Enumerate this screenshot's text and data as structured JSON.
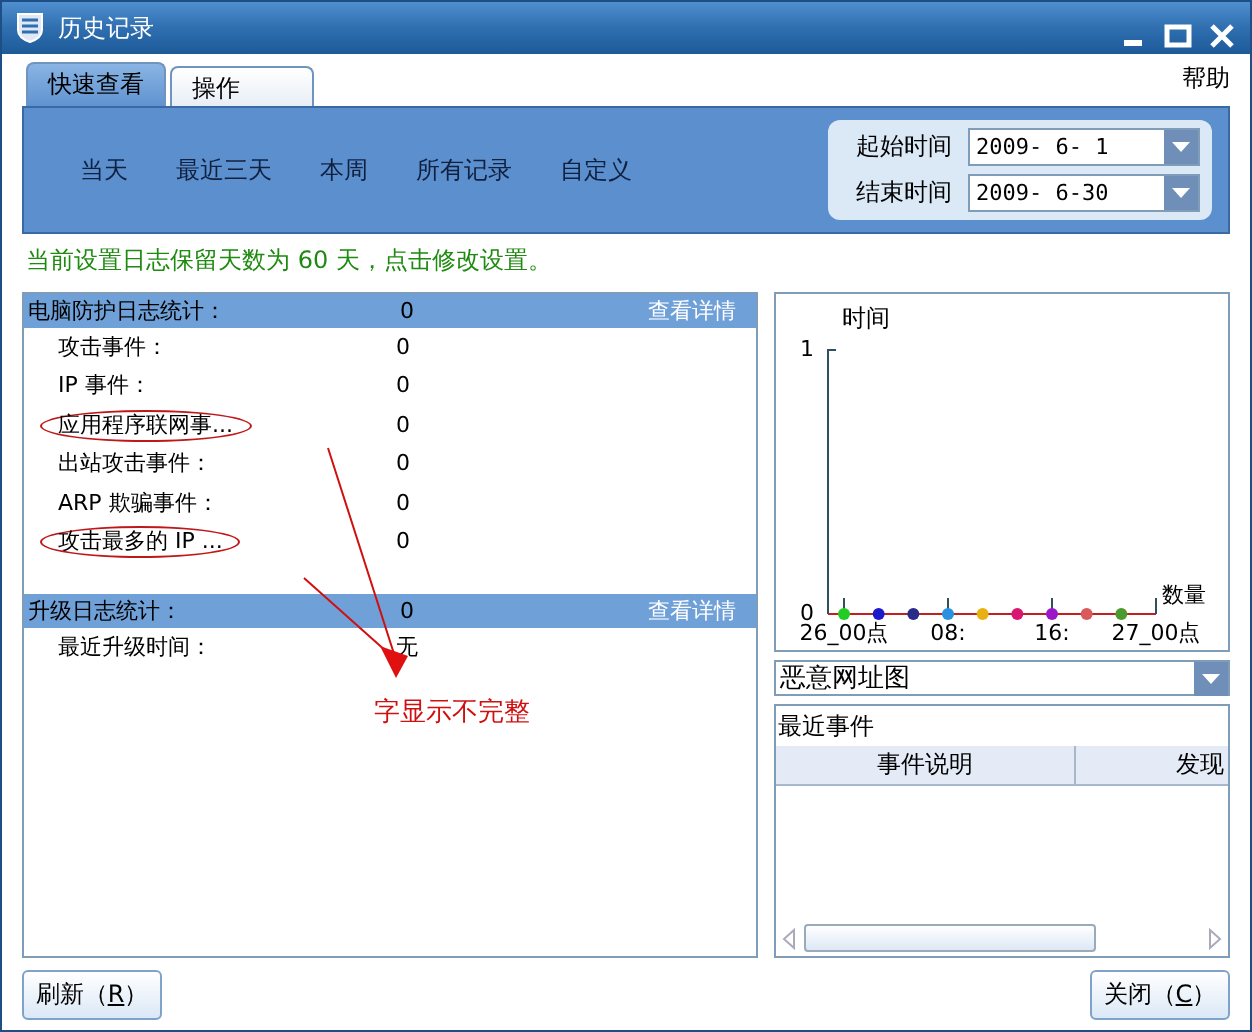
{
  "window": {
    "title": "历史记录"
  },
  "tabs": [
    {
      "label": "快速查看",
      "selected": true
    },
    {
      "label": "操作",
      "selected": false
    }
  ],
  "help_link": "帮助",
  "quick_ranges": [
    "当天",
    "最近三天",
    "本周",
    "所有记录",
    "自定义"
  ],
  "date_range": [
    {
      "label": "起始时间",
      "value": "2009- 6- 1"
    },
    {
      "label": "结束时间",
      "value": "2009- 6-30"
    }
  ],
  "retention_notice": "当前设置日志保留天数为 60 天，点击修改设置。",
  "stat_sections": [
    {
      "title": "电脑防护日志统计：",
      "count": "0",
      "details_link": "查看详情",
      "rows": [
        {
          "label": "攻击事件：",
          "value": "0",
          "circled": false
        },
        {
          "label": "IP 事件：",
          "value": "0",
          "circled": false
        },
        {
          "label": "应用程序联网事...",
          "value": "0",
          "circled": true
        },
        {
          "label": "出站攻击事件：",
          "value": "0",
          "circled": false
        },
        {
          "label": "ARP 欺骗事件：",
          "value": "0",
          "circled": false
        },
        {
          "label": "攻击最多的 IP ...",
          "value": "0",
          "circled": true
        }
      ]
    },
    {
      "title": "升级日志统计：",
      "count": "0",
      "details_link": "查看详情",
      "rows": [
        {
          "label": "最近升级时间：",
          "value": "无",
          "circled": false
        }
      ]
    }
  ],
  "annotation": {
    "text": "字显示不完整"
  },
  "chart_data": {
    "type": "scatter",
    "xlabel": "数量",
    "ylabel": "时间",
    "categories": [
      "26_00点",
      null,
      null,
      "08",
      null,
      null,
      "16",
      null,
      null,
      "27_00点"
    ],
    "ylim": [
      0,
      1
    ],
    "yticks": [
      0,
      1
    ],
    "series": [
      {
        "color": "#22cc22",
        "values": [
          0,
          null,
          null,
          null,
          null,
          null,
          null,
          null,
          null,
          null
        ]
      },
      {
        "color": "#1a1acc",
        "values": [
          null,
          0,
          null,
          null,
          null,
          null,
          null,
          null,
          null,
          null
        ]
      },
      {
        "color": "#2a2a88",
        "values": [
          null,
          null,
          0,
          null,
          null,
          null,
          null,
          null,
          null,
          null
        ]
      },
      {
        "color": "#2a90e0",
        "values": [
          null,
          null,
          null,
          0,
          null,
          null,
          null,
          null,
          null,
          null
        ]
      },
      {
        "color": "#e8b010",
        "values": [
          null,
          null,
          null,
          null,
          0,
          null,
          null,
          null,
          null,
          null
        ]
      },
      {
        "color": "#d81870",
        "values": [
          null,
          null,
          null,
          null,
          null,
          0,
          null,
          null,
          null,
          null
        ]
      },
      {
        "color": "#9a18c8",
        "values": [
          null,
          null,
          null,
          null,
          null,
          null,
          0,
          null,
          null,
          null
        ]
      },
      {
        "color": "#d85a5a",
        "values": [
          null,
          null,
          null,
          null,
          null,
          null,
          null,
          0,
          null,
          null
        ]
      },
      {
        "color": "#4a9a30",
        "values": [
          null,
          null,
          null,
          null,
          null,
          null,
          null,
          null,
          0,
          null
        ]
      }
    ]
  },
  "chart_tick_suffix": ":",
  "chart_selector": "恶意网址图",
  "recent_events": {
    "title": "最近事件",
    "columns": [
      "事件说明",
      "发现"
    ]
  },
  "buttons": [
    {
      "label_before": "刷新（",
      "mnemonic": "R",
      "label_after": "）"
    },
    {
      "label_before": "关闭（",
      "mnemonic": "C",
      "label_after": "）"
    }
  ]
}
